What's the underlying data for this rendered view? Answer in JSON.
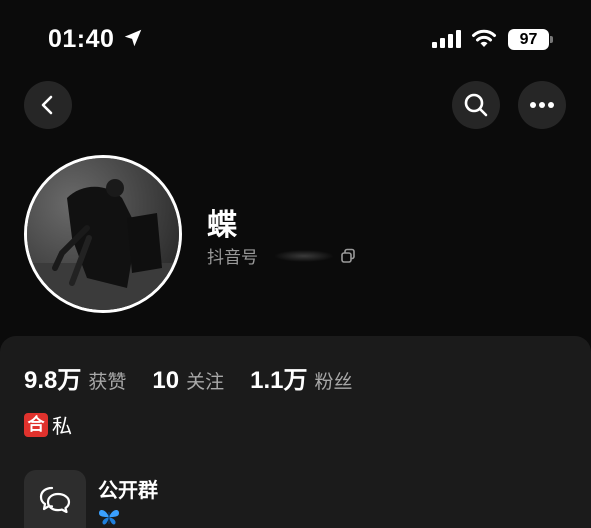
{
  "status_bar": {
    "time": "01:40",
    "battery_level": "97",
    "icons": [
      "location-arrow-icon",
      "signal-icon",
      "wifi-icon",
      "battery-icon"
    ]
  },
  "nav": {
    "icons": [
      "back-chevron-icon",
      "search-icon",
      "more-dots-icon"
    ]
  },
  "profile": {
    "name": "蝶",
    "id_label": "抖音号",
    "id_value_visible": false
  },
  "stats": [
    {
      "value": "9.8万",
      "label": "获赞"
    },
    {
      "value": "10",
      "label": "关注"
    },
    {
      "value": "1.1万",
      "label": "粉丝"
    }
  ],
  "tags": {
    "badge": "合",
    "text": "私"
  },
  "group": {
    "title": "公开群",
    "icon": "chat-bubbles-icon",
    "emoji_icon": "butterfly-icon"
  },
  "colors": {
    "background": "#0b0b0b",
    "card": "#1b1b1b",
    "button": "#262626",
    "badge_red": "#e0322d",
    "muted_text": "#a8a8a8",
    "butterfly_blue": "#3aa0ff"
  }
}
